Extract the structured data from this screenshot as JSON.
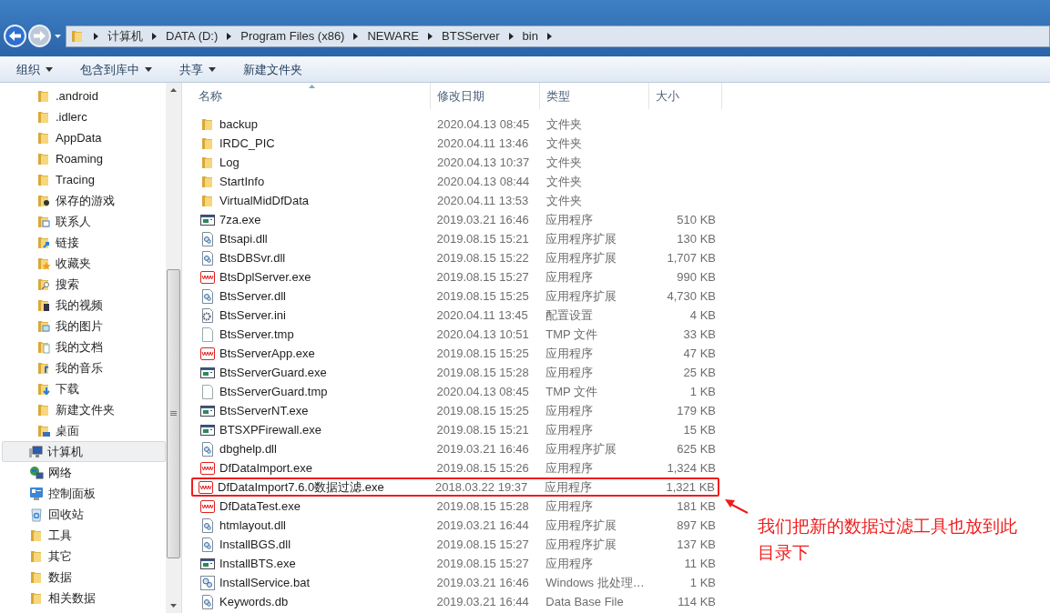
{
  "address_bar": {
    "segments": [
      "计算机",
      "DATA (D:)",
      "Program Files (x86)",
      "NEWARE",
      "BTSServer",
      "bin"
    ]
  },
  "toolbar": {
    "buttons": [
      {
        "label": "组织",
        "dropdown": true
      },
      {
        "label": "包含到库中",
        "dropdown": true
      },
      {
        "label": "共享",
        "dropdown": true
      },
      {
        "label": "新建文件夹",
        "dropdown": false
      }
    ]
  },
  "sidebar": {
    "nested_items": [
      {
        "label": ".android",
        "kind": "folder"
      },
      {
        "label": ".idlerc",
        "kind": "folder"
      },
      {
        "label": "AppData",
        "kind": "folder"
      },
      {
        "label": "Roaming",
        "kind": "folder"
      },
      {
        "label": "Tracing",
        "kind": "folder"
      },
      {
        "label": "保存的游戏",
        "kind": "games"
      },
      {
        "label": "联系人",
        "kind": "contacts"
      },
      {
        "label": "链接",
        "kind": "links"
      },
      {
        "label": "收藏夹",
        "kind": "favorites"
      },
      {
        "label": "搜索",
        "kind": "search"
      },
      {
        "label": "我的视频",
        "kind": "videos"
      },
      {
        "label": "我的图片",
        "kind": "pictures"
      },
      {
        "label": "我的文档",
        "kind": "documents"
      },
      {
        "label": "我的音乐",
        "kind": "music"
      },
      {
        "label": "下载",
        "kind": "downloads"
      },
      {
        "label": "新建文件夹",
        "kind": "folder"
      },
      {
        "label": "桌面",
        "kind": "desktop"
      }
    ],
    "items": [
      {
        "label": "计算机",
        "kind": "computer",
        "selected": true
      },
      {
        "label": "网络",
        "kind": "network",
        "selected": false
      },
      {
        "label": "控制面板",
        "kind": "control-panel",
        "selected": false
      },
      {
        "label": "回收站",
        "kind": "recycle-bin",
        "selected": false
      },
      {
        "label": "工具",
        "kind": "folder",
        "selected": false
      },
      {
        "label": "其它",
        "kind": "folder",
        "selected": false
      },
      {
        "label": "数据",
        "kind": "folder",
        "selected": false
      },
      {
        "label": "相关数据",
        "kind": "folder",
        "selected": false
      }
    ]
  },
  "table": {
    "columns": [
      "名称",
      "修改日期",
      "类型",
      "大小"
    ],
    "rows": [
      {
        "name": "backup",
        "date": "2020.04.13 08:45",
        "type": "文件夹",
        "kind": "folder",
        "highlighted": false
      },
      {
        "name": "IRDC_PIC",
        "date": "2020.04.11 13:46",
        "type": "文件夹",
        "kind": "folder",
        "highlighted": false
      },
      {
        "name": "Log",
        "date": "2020.04.13 10:37",
        "type": "文件夹",
        "kind": "folder",
        "highlighted": false
      },
      {
        "name": "StartInfo",
        "date": "2020.04.13 08:44",
        "type": "文件夹",
        "kind": "folder",
        "highlighted": false
      },
      {
        "name": "VirtualMidDfData",
        "date": "2020.04.11 13:53",
        "type": "文件夹",
        "kind": "folder",
        "highlighted": false
      },
      {
        "name": "7za.exe",
        "date": "2019.03.21 16:46",
        "type": "应用程序",
        "size": "510 KB",
        "kind": "app",
        "highlighted": false
      },
      {
        "name": "Btsapi.dll",
        "date": "2019.08.15 15:21",
        "type": "应用程序扩展",
        "size": "130 KB",
        "kind": "dll",
        "highlighted": false
      },
      {
        "name": "BtsDBSvr.dll",
        "date": "2019.08.15 15:22",
        "type": "应用程序扩展",
        "size": "1,707 KB",
        "kind": "dll",
        "highlighted": false
      },
      {
        "name": "BtsDplServer.exe",
        "date": "2019.08.15 15:27",
        "type": "应用程序",
        "size": "990 KB",
        "kind": "wave-app",
        "highlighted": false
      },
      {
        "name": "BtsServer.dll",
        "date": "2019.08.15 15:25",
        "type": "应用程序扩展",
        "size": "4,730 KB",
        "kind": "dll",
        "highlighted": false
      },
      {
        "name": "BtsServer.ini",
        "date": "2020.04.11 13:45",
        "type": "配置设置",
        "size": "4 KB",
        "kind": "ini",
        "highlighted": false
      },
      {
        "name": "BtsServer.tmp",
        "date": "2020.04.13 10:51",
        "type": "TMP 文件",
        "size": "33 KB",
        "kind": "blank",
        "highlighted": false
      },
      {
        "name": "BtsServerApp.exe",
        "date": "2019.08.15 15:25",
        "type": "应用程序",
        "size": "47 KB",
        "kind": "wave-app",
        "highlighted": false
      },
      {
        "name": "BtsServerGuard.exe",
        "date": "2019.08.15 15:28",
        "type": "应用程序",
        "size": "25 KB",
        "kind": "app",
        "highlighted": false
      },
      {
        "name": "BtsServerGuard.tmp",
        "date": "2020.04.13 08:45",
        "type": "TMP 文件",
        "size": "1 KB",
        "kind": "blank",
        "highlighted": false
      },
      {
        "name": "BtsServerNT.exe",
        "date": "2019.08.15 15:25",
        "type": "应用程序",
        "size": "179 KB",
        "kind": "app",
        "highlighted": false
      },
      {
        "name": "BTSXPFirewall.exe",
        "date": "2019.08.15 15:21",
        "type": "应用程序",
        "size": "15 KB",
        "kind": "app",
        "highlighted": false
      },
      {
        "name": "dbghelp.dll",
        "date": "2019.03.21 16:46",
        "type": "应用程序扩展",
        "size": "625 KB",
        "kind": "dll",
        "highlighted": false
      },
      {
        "name": "DfDataImport.exe",
        "date": "2019.08.15 15:26",
        "type": "应用程序",
        "size": "1,324 KB",
        "kind": "wave-app",
        "highlighted": false
      },
      {
        "name": "DfDataImport7.6.0数据过滤.exe",
        "date": "2018.03.22 19:37",
        "type": "应用程序",
        "size": "1,321 KB",
        "kind": "wave-app",
        "highlighted": true
      },
      {
        "name": "DfDataTest.exe",
        "date": "2019.08.15 15:28",
        "type": "应用程序",
        "size": "181 KB",
        "kind": "wave-app",
        "highlighted": false
      },
      {
        "name": "htmlayout.dll",
        "date": "2019.03.21 16:44",
        "type": "应用程序扩展",
        "size": "897 KB",
        "kind": "dll",
        "highlighted": false
      },
      {
        "name": "InstallBGS.dll",
        "date": "2019.08.15 15:27",
        "type": "应用程序扩展",
        "size": "137 KB",
        "kind": "dll",
        "highlighted": false
      },
      {
        "name": "InstallBTS.exe",
        "date": "2019.08.15 15:27",
        "type": "应用程序",
        "size": "11 KB",
        "kind": "app",
        "highlighted": false
      },
      {
        "name": "InstallService.bat",
        "date": "2019.03.21 16:46",
        "type": "Windows 批处理…",
        "size": "1 KB",
        "kind": "bat",
        "highlighted": false
      },
      {
        "name": "Keywords.db",
        "date": "2019.03.21 16:44",
        "type": "Data Base File",
        "size": "114 KB",
        "kind": "dll",
        "highlighted": false
      }
    ]
  },
  "annotation": {
    "text": "我们把新的数据过滤工具也放到此目录下"
  }
}
